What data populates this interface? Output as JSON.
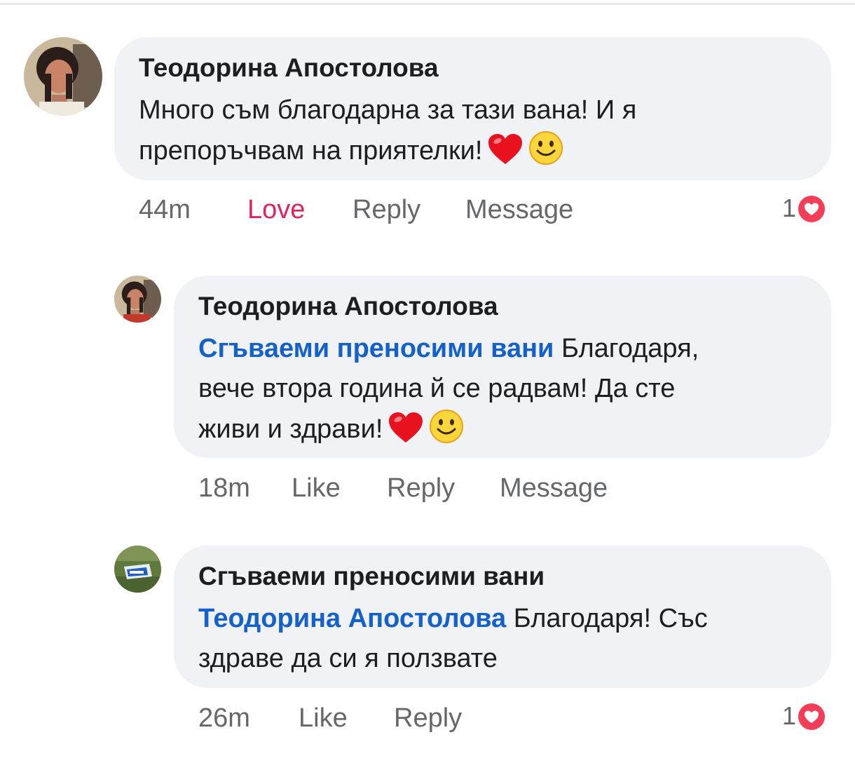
{
  "comments": [
    {
      "author": "Теодорина Апостолова",
      "text_line1": "Много съм благодарна за тази вана! И я",
      "text_line2": "препоръчвам на приятелки!",
      "time": "44m",
      "like_label": "Love",
      "reply_label": "Reply",
      "message_label": "Message",
      "reaction_count": "1"
    },
    {
      "author": "Теодорина Апостолова",
      "mention": "Сгъваеми преносими вани",
      "text_line1": "Благодаря,",
      "text_line2": "вече втора година й се радвам! Да сте",
      "text_line3": "живи и здрави!",
      "time": "18m",
      "like_label": "Like",
      "reply_label": "Reply",
      "message_label": "Message"
    },
    {
      "author": "Сгъваеми преносими вани",
      "mention": "Теодорина Апостолова",
      "text_line1": "Благодаря! Със",
      "text_line2": "здраве да си я ползвате",
      "time": "26m",
      "like_label": "Like",
      "reply_label": "Reply",
      "reaction_count": "1"
    }
  ],
  "colors": {
    "bubble": "#f0f2f5",
    "mention": "#1361c9",
    "love": "#e0245e",
    "meta": "#65676b",
    "heart_reaction": "#f33e58"
  },
  "icons": [
    "red-heart-emoji-icon",
    "smiling-face-emoji-icon",
    "love-reaction-icon"
  ]
}
